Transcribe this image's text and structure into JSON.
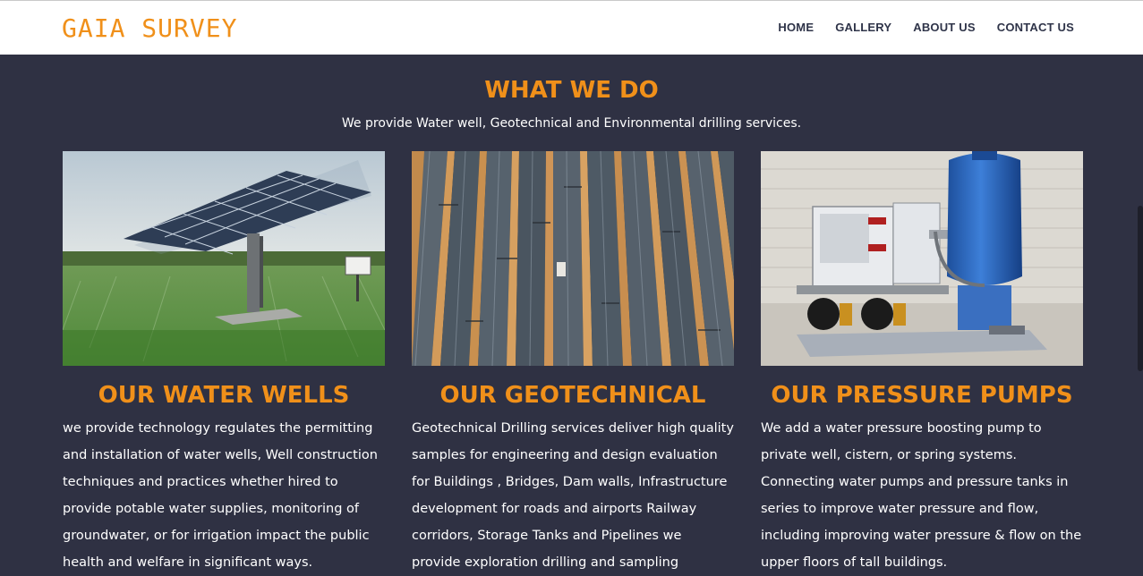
{
  "header": {
    "logo": "GAIA SURVEY",
    "nav": [
      "HOME",
      "GALLERY",
      "ABOUT US",
      "CONTACT US"
    ]
  },
  "section": {
    "title": "WHAT WE DO",
    "subtitle": "We provide Water well, Geotechnical and Environmental drilling services."
  },
  "services": [
    {
      "title": "OUR WATER WELLS",
      "image": "solar-panel-array-in-field",
      "text": "we provide technology regulates the permitting and installation of water wells, Well construction techniques and practices whether hired to provide potable water supplies, monitoring of groundwater, or for irrigation impact the public health and welfare in significant ways."
    },
    {
      "title": "OUR GEOTECHNICAL",
      "image": "drill-core-samples-in-trays",
      "text": "Geotechnical Drilling services deliver high quality samples for engineering and design evaluation for Buildings , Bridges, Dam walls, Infrastructure development for roads and airports Railway corridors, Storage Tanks and Pipelines we provide exploration drilling and sampling services"
    },
    {
      "title": "OUR PRESSURE PUMPS",
      "image": "water-pressure-pump-and-tank",
      "text": "We  add a water pressure boosting pump to private well, cistern, or spring systems. Connecting water pumps and pressure tanks in series to improve water pressure and flow, including improving water pressure & flow on the upper floors of tall buildings."
    }
  ],
  "colors": {
    "accent": "#f0901a",
    "background": "#2f3143",
    "nav_text": "#2f3449"
  }
}
